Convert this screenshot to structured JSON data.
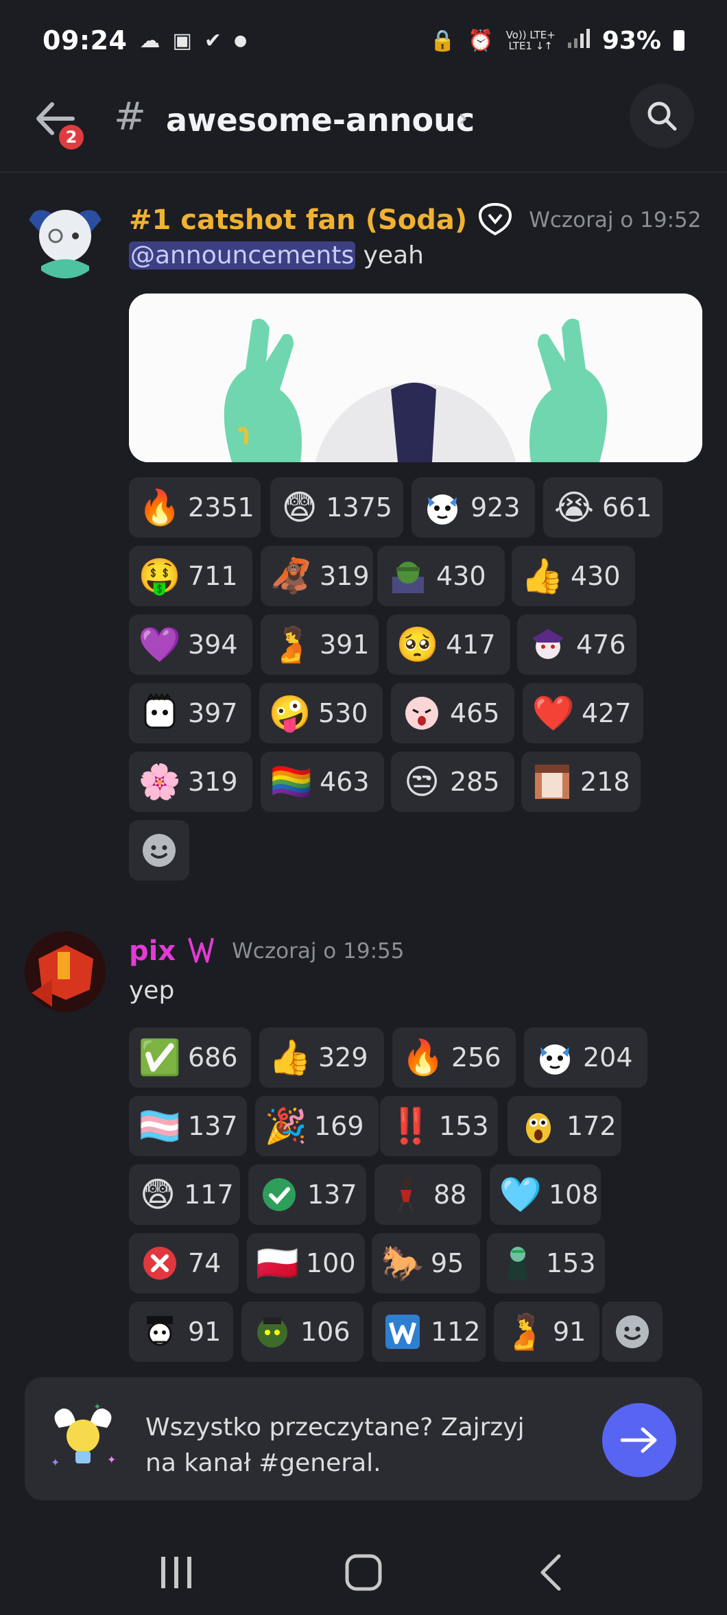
{
  "status_bar": {
    "time": "09:24",
    "left_icons": [
      "cloud-icon",
      "image-icon",
      "check-circle-icon",
      "dot-icon"
    ],
    "network_top": "Vo)) LTE+",
    "network_bottom": "LTE1 ↓↑",
    "battery": "93%"
  },
  "header": {
    "back_badge": "2",
    "hash": "#",
    "channel_name": "awesome-annouc",
    "chevron": "›"
  },
  "messages": [
    {
      "author": "#1 catshot fan (Soda)",
      "author_color": "#f0b232",
      "timestamp": "Wczoraj o 19:52",
      "mention": "@announcements",
      "text": " yeah",
      "reactions": [
        {
          "emoji": "🔥",
          "count": "2351"
        },
        {
          "emoji": "😨",
          "count": "1375"
        },
        {
          "emoji": "custom-cat-icon",
          "count": "923"
        },
        {
          "emoji": "😭",
          "count": "661"
        },
        {
          "emoji": "🤑",
          "count": "711"
        },
        {
          "emoji": "🦧",
          "count": "319"
        },
        {
          "emoji": "custom-goblin-icon",
          "count": "430"
        },
        {
          "emoji": "👍",
          "count": "430"
        },
        {
          "emoji": "💜",
          "count": "394"
        },
        {
          "emoji": "🫄",
          "count": "391"
        },
        {
          "emoji": "🥺",
          "count": "417"
        },
        {
          "emoji": "custom-purple-char-icon",
          "count": "476"
        },
        {
          "emoji": "custom-box-face-icon",
          "count": "397"
        },
        {
          "emoji": "🤪",
          "count": "530"
        },
        {
          "emoji": "custom-pink-face-icon",
          "count": "465"
        },
        {
          "emoji": "❤️",
          "count": "427"
        },
        {
          "emoji": "🌸",
          "count": "319"
        },
        {
          "emoji": "🏳️‍🌈",
          "count": "463"
        },
        {
          "emoji": "😒",
          "count": "285"
        },
        {
          "emoji": "custom-anime-icon",
          "count": "218"
        }
      ]
    },
    {
      "author": "pix",
      "author_color": "#e23bd6",
      "timestamp": "Wczoraj o 19:55",
      "text": "yep",
      "reactions": [
        {
          "emoji": "✅",
          "count": "686"
        },
        {
          "emoji": "👍",
          "count": "329"
        },
        {
          "emoji": "🔥",
          "count": "256"
        },
        {
          "emoji": "custom-cat-icon",
          "count": "204"
        },
        {
          "emoji": "🏳️‍⚧️",
          "count": "137"
        },
        {
          "emoji": "🎉",
          "count": "169"
        },
        {
          "emoji": "‼️",
          "count": "153"
        },
        {
          "emoji": "custom-shocked-icon",
          "count": "172"
        },
        {
          "emoji": "😨",
          "count": "117"
        },
        {
          "emoji": "custom-green-check-icon",
          "count": "137"
        },
        {
          "emoji": "custom-dancer-icon",
          "count": "88"
        },
        {
          "emoji": "🩵",
          "count": "108"
        },
        {
          "emoji": "custom-red-x-icon",
          "count": "74"
        },
        {
          "emoji": "🇵🇱",
          "count": "100"
        },
        {
          "emoji": "🐎",
          "count": "95"
        },
        {
          "emoji": "custom-green-char-icon",
          "count": "153"
        },
        {
          "emoji": "custom-skull-hat-icon",
          "count": "91"
        },
        {
          "emoji": "custom-goblin-bag-icon",
          "count": "106"
        },
        {
          "emoji": "custom-w-icon",
          "count": "112"
        },
        {
          "emoji": "🫄",
          "count": "91"
        }
      ]
    }
  ],
  "banner": {
    "text": "Wszystko przeczytane? Zajrzyj na kanał #general."
  },
  "nav": {
    "recents": "recents-icon",
    "home": "home-icon",
    "back": "back-icon"
  }
}
